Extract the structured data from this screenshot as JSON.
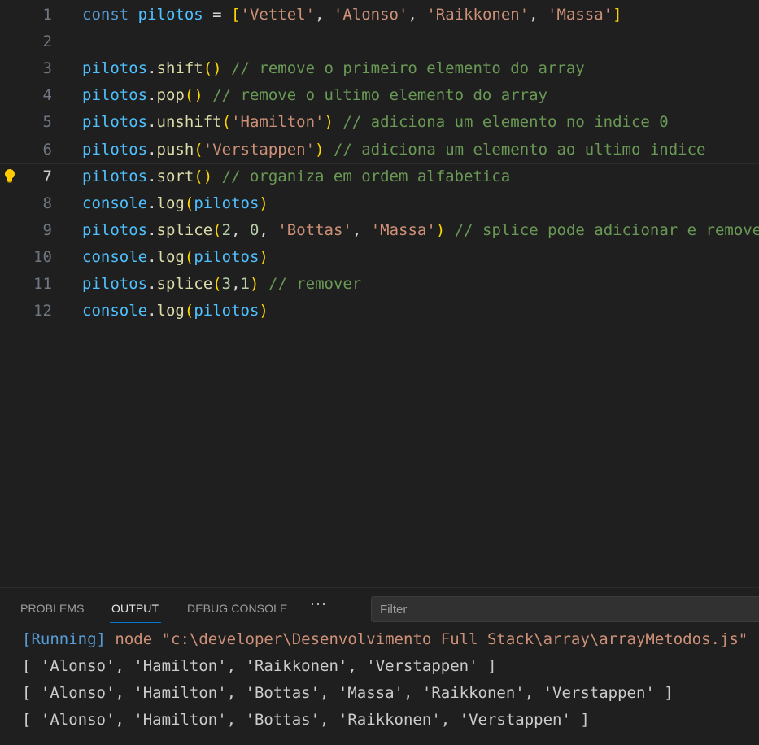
{
  "editor": {
    "lines": [
      {
        "n": "1",
        "tokens": [
          {
            "t": "const ",
            "c": "kw"
          },
          {
            "t": "pilotos",
            "c": "var"
          },
          {
            "t": " = ",
            "c": "op"
          },
          {
            "t": "[",
            "c": "p1"
          },
          {
            "t": "'Vettel'",
            "c": "str"
          },
          {
            "t": ", ",
            "c": "op"
          },
          {
            "t": "'Alonso'",
            "c": "str"
          },
          {
            "t": ", ",
            "c": "op"
          },
          {
            "t": "'Raikkonen'",
            "c": "str"
          },
          {
            "t": ", ",
            "c": "op"
          },
          {
            "t": "'Massa'",
            "c": "str"
          },
          {
            "t": "]",
            "c": "p1"
          }
        ]
      },
      {
        "n": "2",
        "tokens": []
      },
      {
        "n": "3",
        "tokens": [
          {
            "t": "pilotos",
            "c": "var"
          },
          {
            "t": ".",
            "c": "op"
          },
          {
            "t": "shift",
            "c": "fn"
          },
          {
            "t": "()",
            "c": "p1"
          },
          {
            "t": " // remove o primeiro elemento do array",
            "c": "cm"
          }
        ]
      },
      {
        "n": "4",
        "tokens": [
          {
            "t": "pilotos",
            "c": "var"
          },
          {
            "t": ".",
            "c": "op"
          },
          {
            "t": "pop",
            "c": "fn"
          },
          {
            "t": "()",
            "c": "p1"
          },
          {
            "t": " // remove o ultimo elemento do array",
            "c": "cm"
          }
        ]
      },
      {
        "n": "5",
        "tokens": [
          {
            "t": "pilotos",
            "c": "var"
          },
          {
            "t": ".",
            "c": "op"
          },
          {
            "t": "unshift",
            "c": "fn"
          },
          {
            "t": "(",
            "c": "p1"
          },
          {
            "t": "'Hamilton'",
            "c": "str"
          },
          {
            "t": ")",
            "c": "p1"
          },
          {
            "t": " // adiciona um elemento no indice 0",
            "c": "cm"
          }
        ]
      },
      {
        "n": "6",
        "tokens": [
          {
            "t": "pilotos",
            "c": "var"
          },
          {
            "t": ".",
            "c": "op"
          },
          {
            "t": "push",
            "c": "fn"
          },
          {
            "t": "(",
            "c": "p1"
          },
          {
            "t": "'Verstappen'",
            "c": "str"
          },
          {
            "t": ")",
            "c": "p1"
          },
          {
            "t": " // adiciona um elemento ao ultimo indice",
            "c": "cm"
          }
        ]
      },
      {
        "n": "7",
        "current": true,
        "tokens": [
          {
            "t": "pilotos",
            "c": "var"
          },
          {
            "t": ".",
            "c": "op"
          },
          {
            "t": "sort",
            "c": "fn"
          },
          {
            "t": "()",
            "c": "p1"
          },
          {
            "t": " // organiza em ordem alfabetica",
            "c": "cm"
          }
        ]
      },
      {
        "n": "8",
        "tokens": [
          {
            "t": "console",
            "c": "var"
          },
          {
            "t": ".",
            "c": "op"
          },
          {
            "t": "log",
            "c": "fn"
          },
          {
            "t": "(",
            "c": "p1"
          },
          {
            "t": "pilotos",
            "c": "var"
          },
          {
            "t": ")",
            "c": "p1"
          }
        ]
      },
      {
        "n": "9",
        "tokens": [
          {
            "t": "pilotos",
            "c": "var"
          },
          {
            "t": ".",
            "c": "op"
          },
          {
            "t": "splice",
            "c": "fn"
          },
          {
            "t": "(",
            "c": "p1"
          },
          {
            "t": "2",
            "c": "num"
          },
          {
            "t": ", ",
            "c": "op"
          },
          {
            "t": "0",
            "c": "num"
          },
          {
            "t": ", ",
            "c": "op"
          },
          {
            "t": "'Bottas'",
            "c": "str"
          },
          {
            "t": ", ",
            "c": "op"
          },
          {
            "t": "'Massa'",
            "c": "str"
          },
          {
            "t": ")",
            "c": "p1"
          },
          {
            "t": " // splice pode adicionar e remover",
            "c": "cm"
          }
        ]
      },
      {
        "n": "10",
        "tokens": [
          {
            "t": "console",
            "c": "var"
          },
          {
            "t": ".",
            "c": "op"
          },
          {
            "t": "log",
            "c": "fn"
          },
          {
            "t": "(",
            "c": "p1"
          },
          {
            "t": "pilotos",
            "c": "var"
          },
          {
            "t": ")",
            "c": "p1"
          }
        ]
      },
      {
        "n": "11",
        "tokens": [
          {
            "t": "pilotos",
            "c": "var"
          },
          {
            "t": ".",
            "c": "op"
          },
          {
            "t": "splice",
            "c": "fn"
          },
          {
            "t": "(",
            "c": "p1"
          },
          {
            "t": "3",
            "c": "num"
          },
          {
            "t": ",",
            "c": "op"
          },
          {
            "t": "1",
            "c": "num"
          },
          {
            "t": ")",
            "c": "p1"
          },
          {
            "t": " // remover",
            "c": "cm"
          }
        ]
      },
      {
        "n": "12",
        "tokens": [
          {
            "t": "console",
            "c": "var"
          },
          {
            "t": ".",
            "c": "op"
          },
          {
            "t": "log",
            "c": "fn"
          },
          {
            "t": "(",
            "c": "p1"
          },
          {
            "t": "pilotos",
            "c": "var"
          },
          {
            "t": ")",
            "c": "p1"
          }
        ]
      }
    ],
    "lightbulb_icon": "lightbulb-icon"
  },
  "panel": {
    "tabs": [
      {
        "label": "PROBLEMS",
        "active": false
      },
      {
        "label": "OUTPUT",
        "active": true
      },
      {
        "label": "DEBUG CONSOLE",
        "active": false
      }
    ],
    "more_label": "···",
    "filter_placeholder": "Filter"
  },
  "output": {
    "running_tag": "[Running]",
    "running_cmd": " node \"c:\\developer\\Desenvolvimento Full Stack\\array\\arrayMetodos.js\"",
    "lines": [
      "[ 'Alonso', 'Hamilton', 'Raikkonen', 'Verstappen' ]",
      "[ 'Alonso', 'Hamilton', 'Bottas', 'Massa', 'Raikkonen', 'Verstappen' ]",
      "[ 'Alonso', 'Hamilton', 'Bottas', 'Raikkonen', 'Verstappen' ]"
    ]
  },
  "colors": {
    "background": "#1f1f1f",
    "keyword": "#569cd6",
    "variable": "#4fc1ff",
    "function": "#dcdcaa",
    "string": "#ce9178",
    "number": "#b5cea8",
    "comment": "#6a9955",
    "bracket": "#ffd700",
    "accent": "#0078d4"
  }
}
